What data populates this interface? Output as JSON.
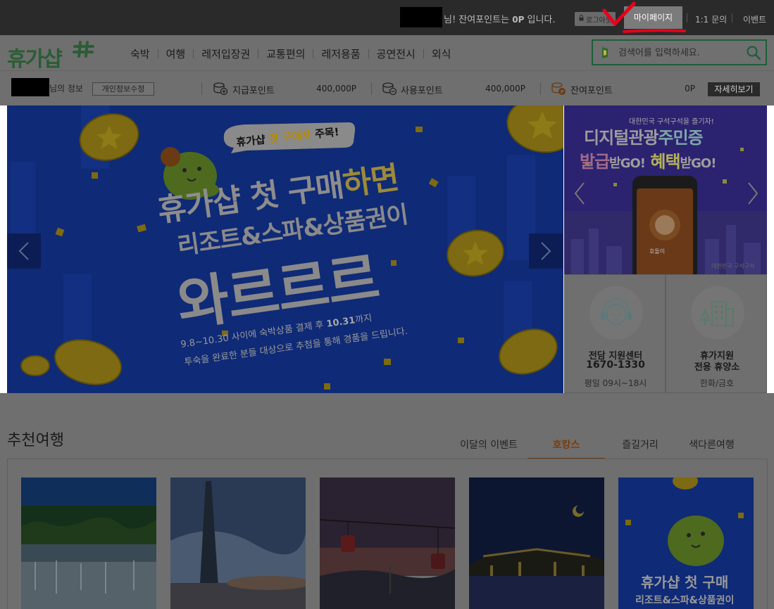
{
  "topbar": {
    "greeting_suffix": "님! 잔여포인트는",
    "points": "0P",
    "greeting_end": "입니다.",
    "logout_label": "로그아웃",
    "mypage_label": "마이페이지",
    "links": [
      "1:1 문의",
      "이벤트"
    ]
  },
  "header": {
    "logo_text": "휴가샵",
    "nav": [
      "숙박",
      "여행",
      "레저입장권",
      "교통편의",
      "레저용품",
      "공연전시",
      "외식"
    ],
    "search_placeholder": "검색어를 입력하세요."
  },
  "infobar": {
    "user_suffix": "님의 정보",
    "edit_label": "개인정보수정",
    "points": [
      {
        "label": "지급포인트",
        "value": "400,000P"
      },
      {
        "label": "사용포인트",
        "value": "400,000P"
      },
      {
        "label": "잔여포인트",
        "value": "0P"
      }
    ],
    "detail_label": "자세히보기"
  },
  "main_banner": {
    "badge_prefix": "휴가샵",
    "badge_highlight": "첫 구매자",
    "badge_suffix": "주목!",
    "line1_prefix": "휴가샵 첫 구매",
    "line1_suffix": "하면",
    "line2": "리조트&스파&상품권이",
    "line3": "와르르르",
    "line4_prefix": "9.8~10.30 사이에 숙박상품 결제 후",
    "line4_date": "10.31",
    "line4_suffix": "까지",
    "line5": "투숙을 완료한 분들 대상으로 추첨을 통해 경품을 드립니다."
  },
  "side_banner": {
    "sub": "대한민국 구석구석을 즐기자!",
    "title1_prefix": "디지털관광",
    "title1_highlight": "주민증",
    "title2_part1": "발급",
    "title2_part2": "받GO!",
    "title2_part3": "혜택",
    "title2_part4": "받GO!",
    "phone_label": "호돌이",
    "footer": "대한민국 구석구석"
  },
  "services": [
    {
      "title": "전담 지원센터",
      "number": "1670-1330",
      "note": "평일 09시~18시",
      "icon": "headset-icon"
    },
    {
      "title_line1": "휴가지원",
      "title_line2": "전용 휴양소",
      "note": "한화/금호",
      "icon": "building-icon"
    }
  ],
  "recommended": {
    "title": "추천여행",
    "tabs": [
      "이달의 이벤트",
      "호캉스",
      "즐길거리",
      "색다른여행"
    ],
    "active_tab": 1,
    "promo_line1": "휴가샵 첫 구매",
    "promo_line2_a": "리조트",
    "promo_line2_b": "&스파",
    "promo_line2_c": "&상품권이"
  },
  "colors": {
    "accent_green": "#1c5e3a",
    "active_tab": "#7a3b0f",
    "annotation_red": "#e8001c"
  }
}
